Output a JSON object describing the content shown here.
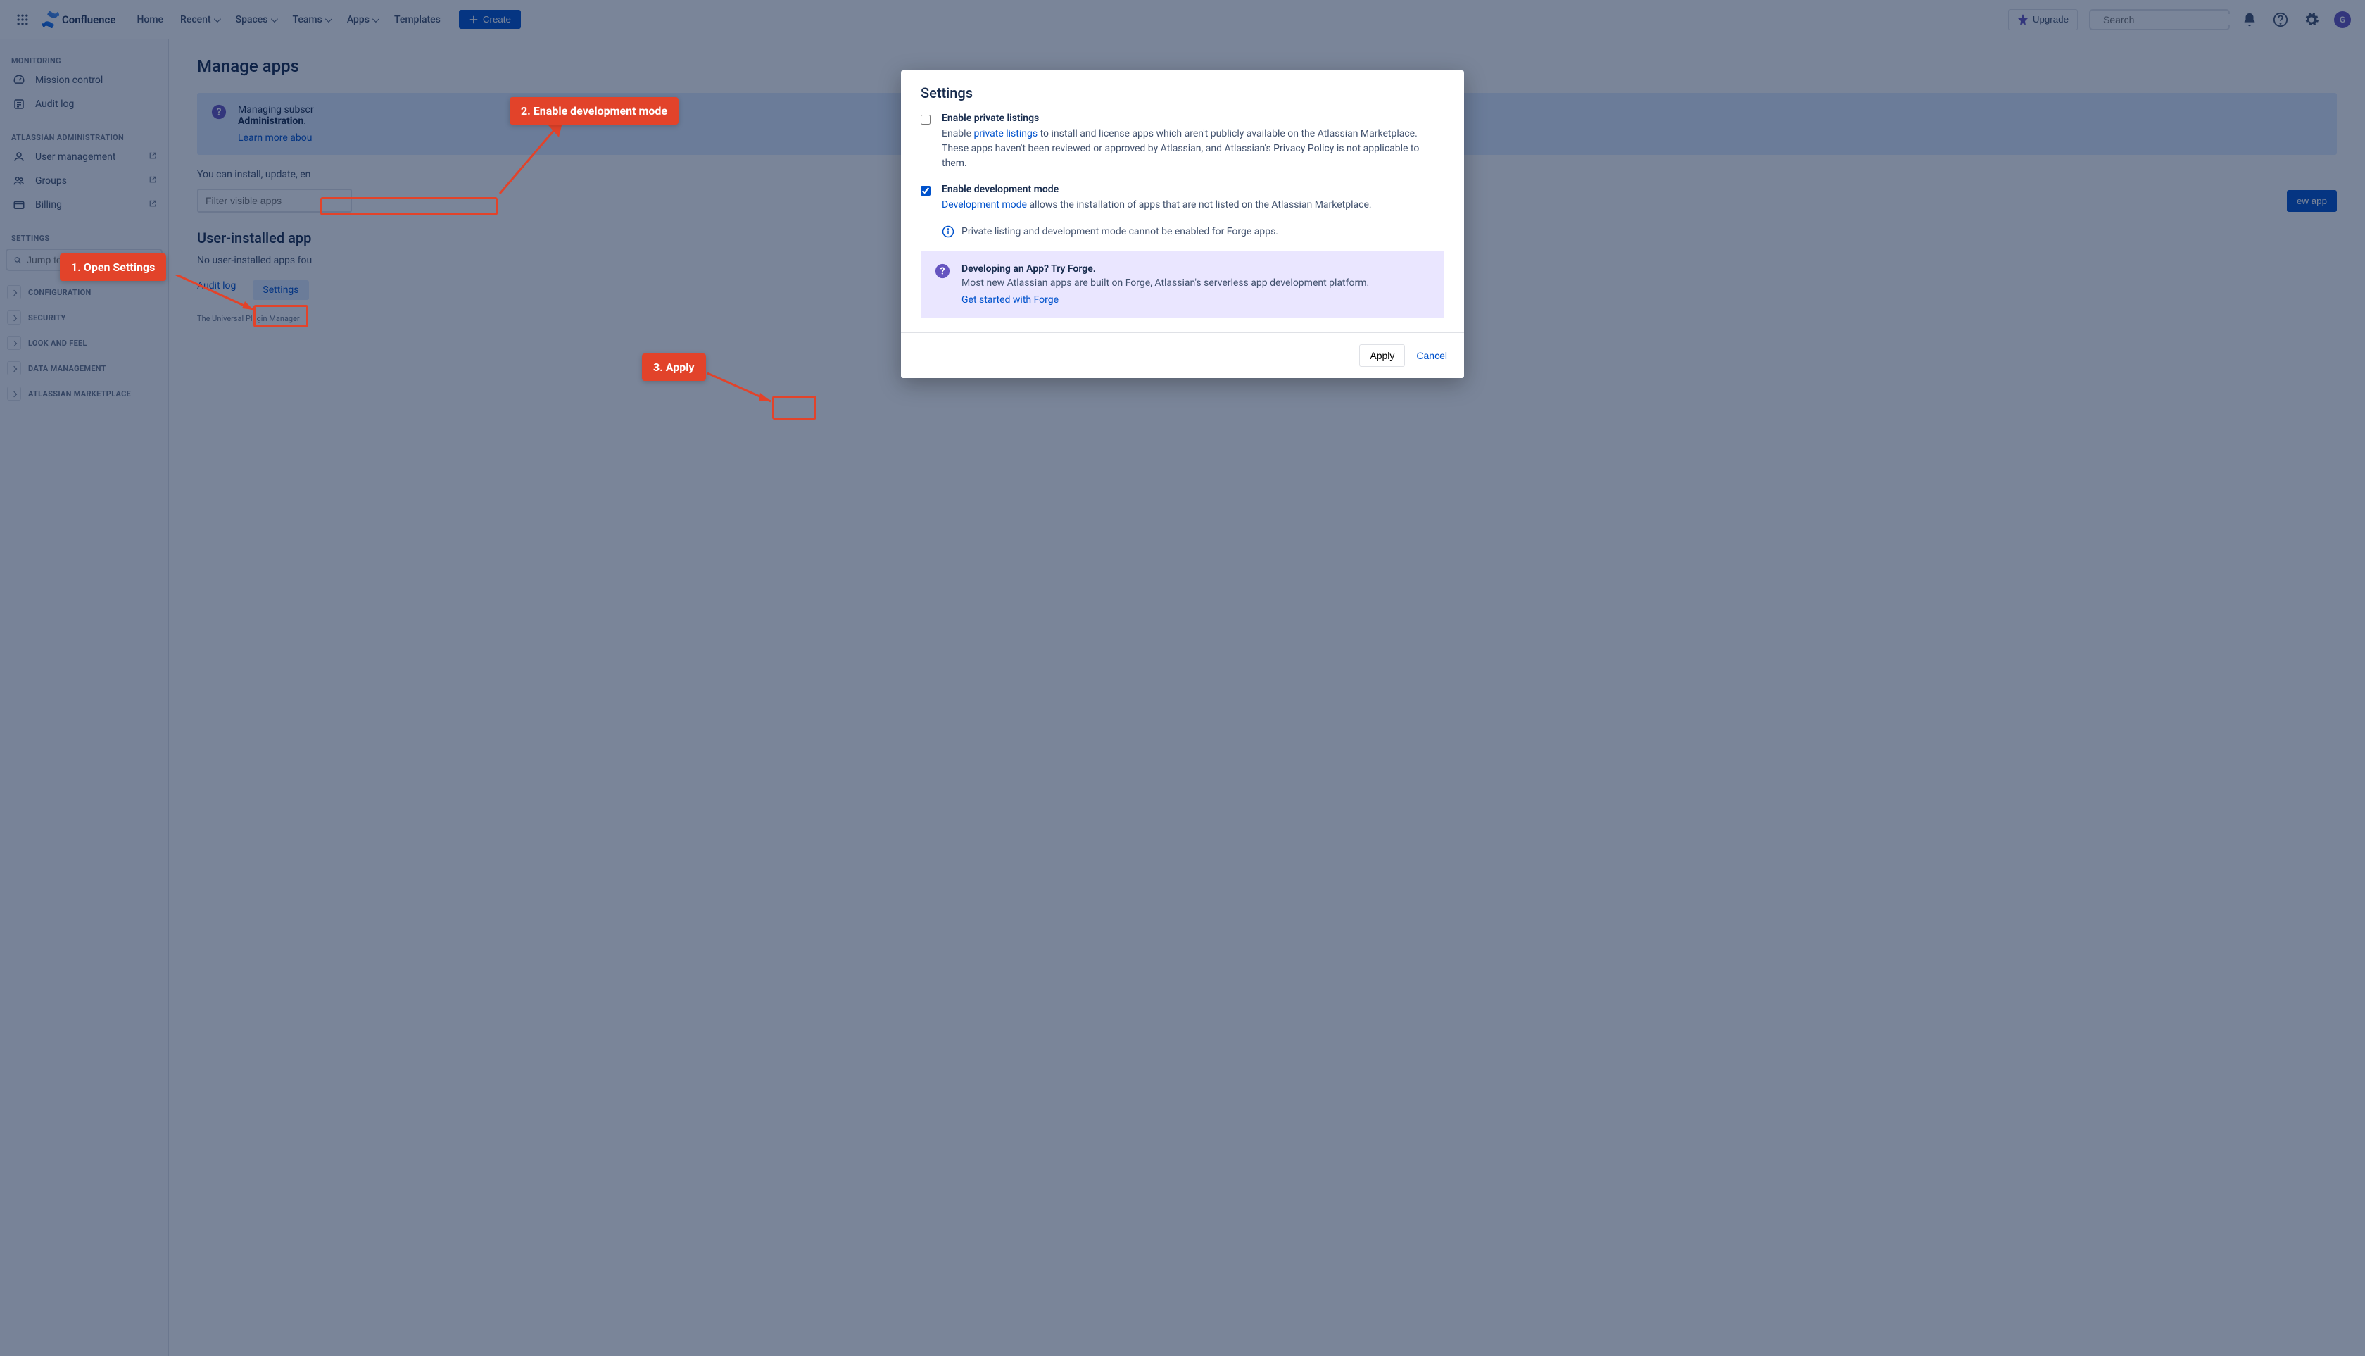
{
  "header": {
    "app_name": "Confluence",
    "nav": [
      "Home",
      "Recent",
      "Spaces",
      "Teams",
      "Apps",
      "Templates"
    ],
    "create_label": "Create",
    "upgrade_label": "Upgrade",
    "search_placeholder": "Search",
    "avatar_initial": "G"
  },
  "sidebar": {
    "monitoring_title": "MONITORING",
    "monitoring_items": [
      "Mission control",
      "Audit log"
    ],
    "admin_title": "ATLASSIAN ADMINISTRATION",
    "admin_items": [
      "User management",
      "Groups",
      "Billing"
    ],
    "settings_title": "SETTINGS",
    "settings_search_placeholder": "Jump to setting...",
    "accordion": [
      "CONFIGURATION",
      "SECURITY",
      "LOOK AND FEEL",
      "DATA MANAGEMENT",
      "ATLASSIAN MARKETPLACE"
    ]
  },
  "main": {
    "title": "Manage apps",
    "banner_text1": "Managing subscr",
    "banner_text2": "Administration",
    "banner_link": "Learn more abou",
    "filter_placeholder": "Filter visible apps",
    "desc_text": "You can install, update, en",
    "build_app_label": "ew app",
    "section_title": "User-installed app",
    "empty_text": "No user-installed apps fou",
    "audit_link": "Audit log",
    "settings_link": "Settings",
    "version": "The Universal Plugin Manager"
  },
  "modal": {
    "title": "Settings",
    "private_title": "Enable private listings",
    "private_desc_pre": "Enable ",
    "private_link": "private listings",
    "private_desc_post": " to install and license apps which aren't publicly available on the Atlassian Marketplace. These apps haven't been reviewed or approved by Atlassian, and Atlassian's Privacy Policy is not applicable to them.",
    "dev_title": "Enable development mode",
    "dev_link": "Development mode",
    "dev_desc_post": " allows the installation of apps that are not listed on the Atlassian Marketplace.",
    "info_note": "Private listing and development mode cannot be enabled for Forge apps.",
    "callout_title": "Developing an App? Try Forge.",
    "callout_desc": "Most new Atlassian apps are built on Forge, Atlassian's serverless app development platform.",
    "callout_link": "Get started with Forge",
    "apply_label": "Apply",
    "cancel_label": "Cancel"
  },
  "annotations": {
    "step1": "1. Open Settings",
    "step2": "2. Enable development mode",
    "step3": "3. Apply"
  }
}
